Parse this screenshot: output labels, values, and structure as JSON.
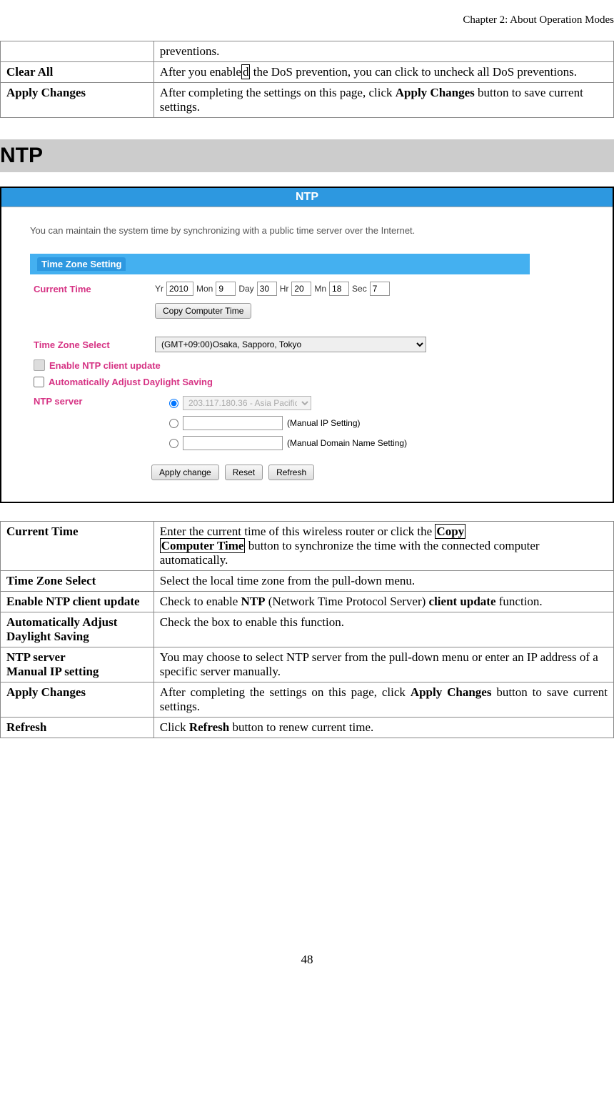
{
  "page": {
    "header": "Chapter 2: About Operation Modes",
    "number": "48"
  },
  "top_table": {
    "rows": [
      {
        "label": "",
        "desc": "preventions."
      },
      {
        "label": "Clear All",
        "desc_pre": "After you enable",
        "desc_box": "d",
        "desc_post": " the DoS prevention, you can click to uncheck all DoS preventions."
      },
      {
        "label": "Apply Changes",
        "desc_pre": "After completing the settings on this page, click ",
        "desc_bold": "Apply Changes",
        "desc_post": " button to save current settings."
      }
    ]
  },
  "section_heading": "NTP",
  "screenshot": {
    "banner": "NTP",
    "intro": "You can maintain the system time by synchronizing with a public time server over the Internet.",
    "section_bar": "Time Zone Setting",
    "current_time_label": "Current Time",
    "time": {
      "yr_lbl": "Yr",
      "yr_val": "2010",
      "mon_lbl": "Mon",
      "mon_val": "9",
      "day_lbl": "Day",
      "day_val": "30",
      "hr_lbl": "Hr",
      "hr_val": "20",
      "mn_lbl": "Mn",
      "mn_val": "18",
      "sec_lbl": "Sec",
      "sec_val": "7"
    },
    "copy_btn": "Copy Computer Time",
    "tz_label": "Time Zone  Select",
    "tz_value": "(GMT+09:00)Osaka, Sapporo, Tokyo",
    "enable_ntp": "Enable NTP client update",
    "auto_daylight": "Automatically Adjust Daylight Saving",
    "ntp_server_label": "NTP server",
    "ntp_dropdown": "203.117.180.36 - Asia Pacific",
    "manual_ip": "(Manual IP Setting)",
    "manual_domain": "(Manual Domain Name Setting)",
    "apply_change_btn": "Apply change",
    "reset_btn": "Reset",
    "refresh_btn": "Refresh"
  },
  "bottom_table": {
    "rows": [
      {
        "label": "Current Time",
        "type": "current_time",
        "t1": "Enter the current time of this wireless router or click the ",
        "boxed1": "Copy",
        "boxed2": "Computer Time",
        "t2": " button to synchronize the time with the connected computer automatically."
      },
      {
        "label": "Time Zone Select",
        "type": "plain",
        "desc": "Select the local time zone from the pull-down menu."
      },
      {
        "label": "Enable NTP client update",
        "type": "enable_ntp",
        "t1": "Check to enable ",
        "b1": "NTP",
        "t2": " (Network Time Protocol Server) ",
        "b2": "client update",
        "t3": " function."
      },
      {
        "label": "Automatically Adjust Daylight Saving",
        "type": "plain",
        "desc": "Check the box to enable this function."
      },
      {
        "label": "NTP server\nManual IP setting",
        "type": "plain",
        "desc": "You may choose to select NTP server from the pull-down menu or enter an IP address of a specific server manually."
      },
      {
        "label": "Apply Changes",
        "type": "apply",
        "t1": "After completing the settings on this page, click ",
        "b1": "Apply Changes",
        "t2": " button to save current settings."
      },
      {
        "label": "Refresh",
        "type": "refresh",
        "t1": "Click ",
        "b1": "Refresh",
        "t2": " button to renew current time."
      }
    ]
  }
}
